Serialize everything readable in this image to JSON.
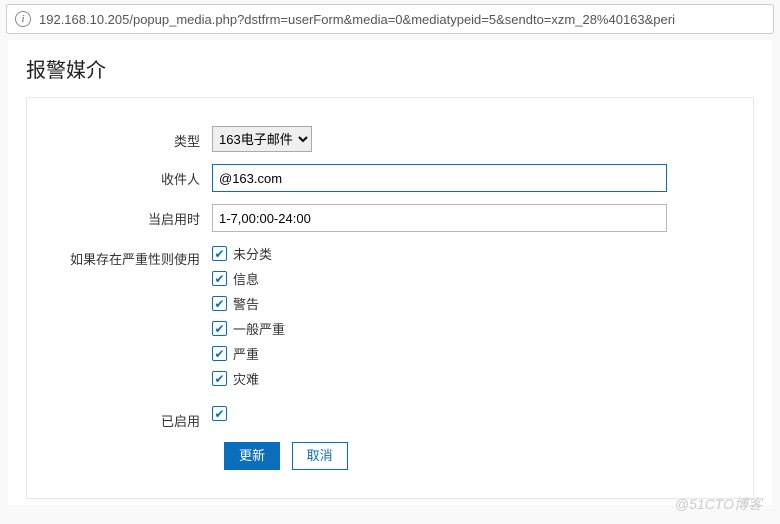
{
  "address_bar": {
    "url": "192.168.10.205/popup_media.php?dstfrm=userForm&media=0&mediatypeid=5&sendto=xzm_28%40163&peri"
  },
  "page_title": "报警媒介",
  "form": {
    "type_label": "类型",
    "type_value": "163电子邮件",
    "recipient_label": "收件人",
    "recipient_value": "@163.com",
    "when_active_label": "当启用时",
    "when_active_value": "1-7,00:00-24:00",
    "severity_label": "如果存在严重性则使用",
    "severities": [
      {
        "label": "未分类",
        "checked": true
      },
      {
        "label": "信息",
        "checked": true
      },
      {
        "label": "警告",
        "checked": true
      },
      {
        "label": "一般严重",
        "checked": true
      },
      {
        "label": "严重",
        "checked": true
      },
      {
        "label": "灾难",
        "checked": true
      }
    ],
    "enabled_label": "已启用",
    "enabled_checked": true,
    "update_button": "更新",
    "cancel_button": "取消"
  },
  "watermark": "@51CTO博客"
}
